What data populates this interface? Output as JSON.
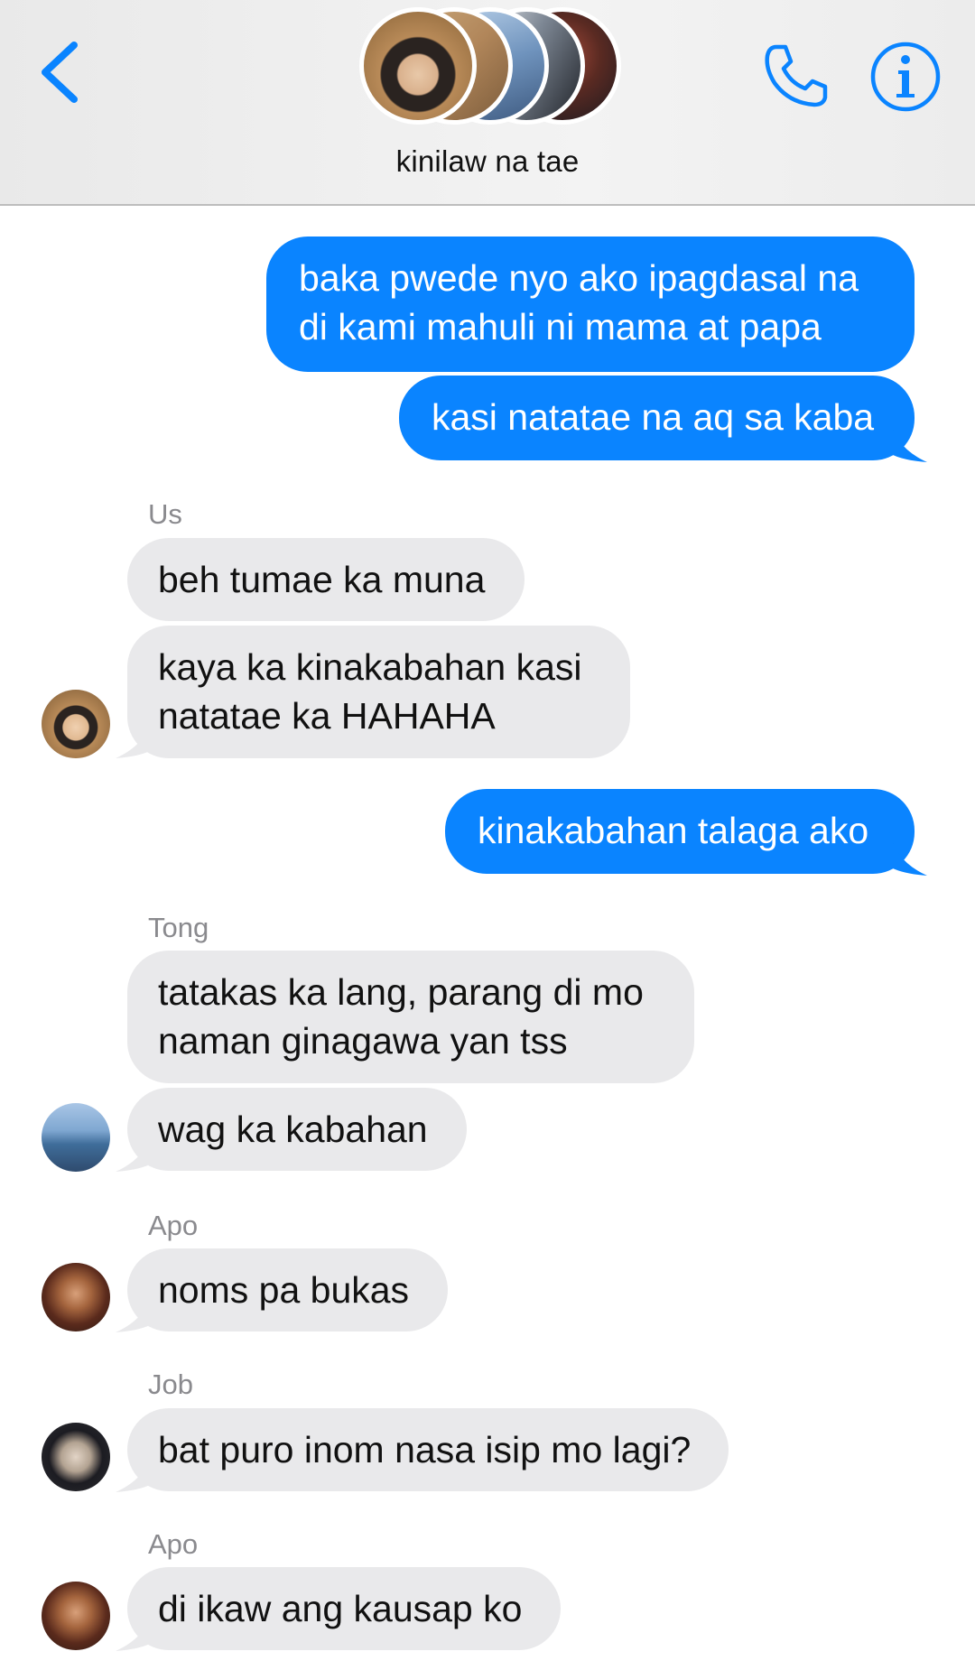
{
  "header": {
    "group_name": "kinilaw na tae",
    "back_icon": "chevron-left-icon",
    "call_icon": "phone-icon",
    "info_icon": "info-icon",
    "accent_color": "#0a84ff"
  },
  "messages": [
    {
      "direction": "outgoing",
      "lines": [
        "baka pwede nyo ako ipagdasal na",
        "di kami mahuli ni mama at papa"
      ]
    },
    {
      "direction": "outgoing",
      "lines": [
        "kasi natatae na aq sa kaba"
      ]
    },
    {
      "sender": "Us",
      "direction": "incoming",
      "lines": [
        "beh tumae ka muna"
      ]
    },
    {
      "direction": "incoming",
      "lines": [
        "kaya ka kinakabahan kasi",
        "natatae ka HAHAHA"
      ]
    },
    {
      "direction": "outgoing",
      "lines": [
        "kinakabahan talaga ako"
      ]
    },
    {
      "sender": "Tong",
      "direction": "incoming",
      "lines": [
        "tatakas ka lang, parang di mo",
        "naman ginagawa yan tss"
      ]
    },
    {
      "direction": "incoming",
      "lines": [
        "wag ka kabahan"
      ]
    },
    {
      "sender": "Apo",
      "direction": "incoming",
      "lines": [
        "noms pa bukas"
      ]
    },
    {
      "sender": "Job",
      "direction": "incoming",
      "lines": [
        "bat puro inom nasa isip mo lagi?"
      ]
    },
    {
      "sender": "Apo",
      "direction": "incoming",
      "lines": [
        "di ikaw ang kausap ko"
      ]
    }
  ],
  "colors": {
    "outgoing_bubble": "#0a84ff",
    "incoming_bubble": "#e9e9eb",
    "sender_label": "#8a8a8e"
  }
}
